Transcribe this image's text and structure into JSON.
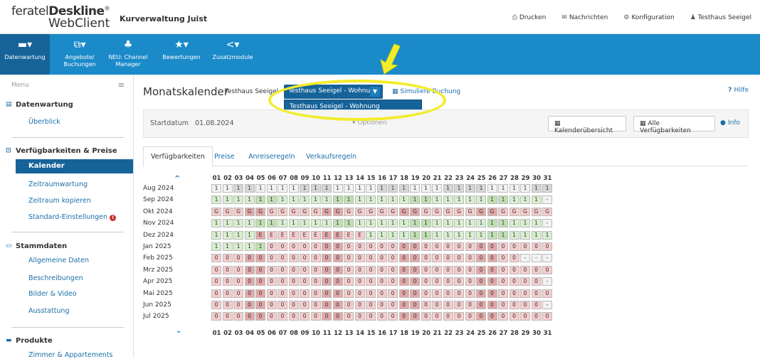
{
  "header": {
    "logo_line1_a": "feratel",
    "logo_line1_b": "Deskline",
    "logo_reg": "®",
    "logo_line2": "WebClient",
    "org": "Kurverwaltung Juist",
    "links": [
      {
        "icon": "printer-icon",
        "glyph": "⎙",
        "label": "Drucken"
      },
      {
        "icon": "envelope-icon",
        "glyph": "✉",
        "label": "Nachrichten"
      },
      {
        "icon": "gear-icon",
        "glyph": "⚙",
        "label": "Konfiguration"
      },
      {
        "icon": "user-icon",
        "glyph": "♟",
        "label": "Testhaus Seeigel"
      }
    ]
  },
  "nav": [
    {
      "icon": "bed-icon",
      "glyph": "▬▾",
      "label1": "Datenwartung",
      "label2": "",
      "active": true
    },
    {
      "icon": "offers-icon",
      "glyph": "⧉▾",
      "label1": "Angebote/",
      "label2": "Buchungen",
      "active": false
    },
    {
      "icon": "sitemap-icon",
      "glyph": "♣",
      "label1": "NEU: Channel",
      "label2": "Manager",
      "active": false
    },
    {
      "icon": "star-icon",
      "glyph": "★▾",
      "label1": "Bewertungen",
      "label2": "",
      "active": false
    },
    {
      "icon": "share-icon",
      "glyph": "<▾",
      "label1": "Zusatzmodule",
      "label2": "",
      "active": false
    }
  ],
  "sidebar": {
    "menu_label": "Menu",
    "sections": [
      {
        "icon": "doc-icon",
        "glyph": "▤",
        "title": "Datenwartung",
        "items": [
          "Überblick"
        ]
      },
      {
        "icon": "availability-icon",
        "glyph": "⊡",
        "title": "Verfügbarkeiten & Preise",
        "items": [
          "Kalender",
          "Zeitraumwartung",
          "Zeitraum kopieren",
          "Standard-Einstellungen"
        ]
      },
      {
        "icon": "card-icon",
        "glyph": "▭",
        "title": "Stammdaten",
        "items": [
          "Allgemeine Daten",
          "Beschreibungen",
          "Bilder & Video",
          "Ausstattung"
        ]
      },
      {
        "icon": "bed-icon",
        "glyph": "▬",
        "title": "Produkte",
        "items": [
          "Zimmer & Appartements"
        ]
      }
    ],
    "active_item": "Kalender",
    "warn_glyph": "!"
  },
  "main": {
    "title": "Monatskalender",
    "subtitle": "Testhaus Seeigel",
    "select_value": "Testhaus Seeigel - Wohnun",
    "dropdown_option": "Testhaus Seeigel - Wohnung Seeigelchen",
    "simulate_label": "Simuliere Buchung",
    "help_label": "Hilfe",
    "start_label": "Startdatum",
    "start_value": "01.08.2024",
    "options_label": "Optionen",
    "calendar_overview": "Kalenderübersicht",
    "all_availabilities": "Alle Verfügbarkeiten",
    "info_label": "Info",
    "tabs": [
      "Verfügbarkeiten",
      "Preise",
      "Anreiseregeln",
      "Verkaufsregeln"
    ]
  },
  "calendar": {
    "days": [
      "01",
      "02",
      "03",
      "04",
      "05",
      "06",
      "07",
      "08",
      "09",
      "10",
      "11",
      "12",
      "13",
      "14",
      "15",
      "16",
      "17",
      "18",
      "19",
      "20",
      "21",
      "22",
      "23",
      "24",
      "25",
      "26",
      "27",
      "28",
      "29",
      "30",
      "31"
    ],
    "colors": {
      "green": "#d8efcf",
      "green_dark": "#bfe0b1",
      "red": "#f6cccc",
      "red_dark": "#e3a8a8",
      "grey": "#f2f2f2",
      "grey_dark": "#d6d6d6"
    },
    "rows": [
      {
        "month": "Aug 2024",
        "cells": "1111111111111111111111111111111",
        "kind": "mixed_aug"
      },
      {
        "month": "Sep 2024",
        "cells": "111111111111111111111111111111-",
        "kind": "green"
      },
      {
        "month": "Okt 2024",
        "cells": "GGGGGGGGGGGGGGGGGGGGGGGGGGGGGGG",
        "kind": "red"
      },
      {
        "month": "Nov 2024",
        "cells": "111111111111111111111111111111-",
        "kind": "green"
      },
      {
        "month": "Dez 2024",
        "cells": "1111EEEEEEEEEE11111111111111111",
        "kind": "dez"
      },
      {
        "month": "Jan 2025",
        "cells": "1111100000000000000000000000000",
        "kind": "jan"
      },
      {
        "month": "Feb 2025",
        "cells": "0000000000000000000000000000---",
        "kind": "red"
      },
      {
        "month": "Mrz 2025",
        "cells": "0000000000000000000000000000000",
        "kind": "red"
      },
      {
        "month": "Apr 2025",
        "cells": "000000000000000000000000000000-",
        "kind": "red"
      },
      {
        "month": "Mai 2025",
        "cells": "0000000000000000000000000000000",
        "kind": "red"
      },
      {
        "month": "Jun 2025",
        "cells": "000000000000000000000000000000-",
        "kind": "red"
      },
      {
        "month": "Jul 2025",
        "cells": "0000000000000000000000000000000",
        "kind": "red"
      }
    ]
  }
}
